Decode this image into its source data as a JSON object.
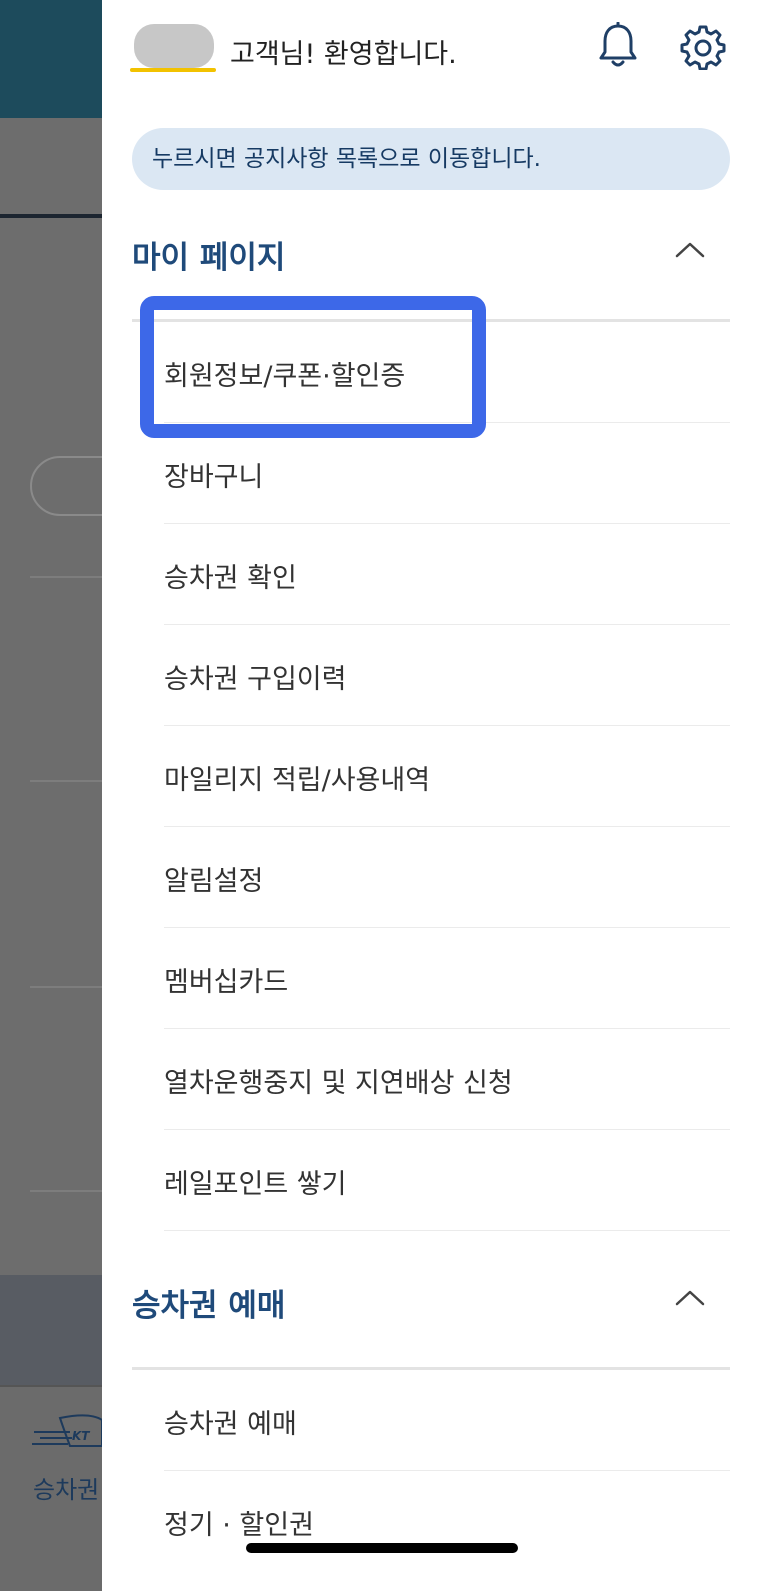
{
  "background": {
    "tab_label": "승차권"
  },
  "header": {
    "welcome": "고객님! 환영합니다.",
    "icons": [
      "bell-icon",
      "gear-icon"
    ]
  },
  "notice": "누르시면 공지사항 목록으로 이동합니다.",
  "sections": [
    {
      "title": "마이 페이지",
      "items": [
        "회원정보/쿠폰·할인증",
        "장바구니",
        "승차권 확인",
        "승차권 구입이력",
        "마일리지 적립/사용내역",
        "알림설정",
        "멤버십카드",
        "열차운행중지 및 지연배상 신청",
        "레일포인트 쌓기"
      ]
    },
    {
      "title": "승차권 예매",
      "items": [
        "승차권 예매",
        "정기 · 할인권"
      ]
    }
  ],
  "colors": {
    "accent": "#1f4a7a",
    "notice_bg": "#dbe7f3",
    "highlight": "#3d68e8",
    "underline": "#f2c200"
  }
}
